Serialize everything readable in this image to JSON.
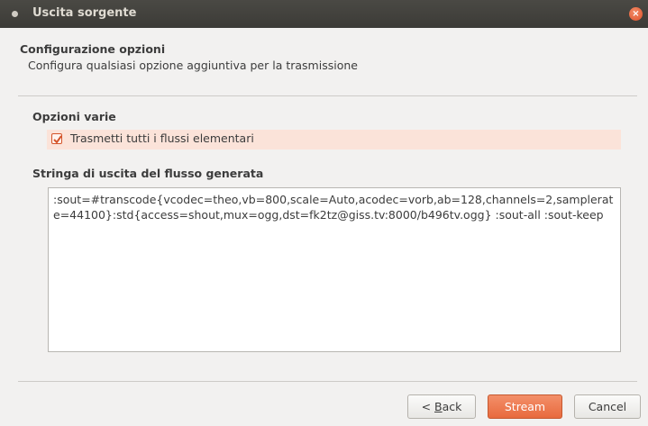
{
  "window": {
    "title": "Uscita sorgente",
    "close_glyph": "×"
  },
  "header": {
    "title": "Configurazione opzioni",
    "subtitle": "Configura qualsiasi opzione aggiuntiva per la trasmissione"
  },
  "misc_options": {
    "title": "Opzioni varie",
    "checkbox_label": "Trasmetti tutti i flussi elementari",
    "checked": true
  },
  "output_string": {
    "title": "Stringa di uscita del flusso generata",
    "value": ":sout=#transcode{vcodec=theo,vb=800,scale=Auto,acodec=vorb,ab=128,channels=2,samplerate=44100}:std{access=shout,mux=ogg,dst=fk2tz@giss.tv:8000/b496tv.ogg} :sout-all :sout-keep"
  },
  "buttons": {
    "back_prefix": "< ",
    "back_mnemonic": "B",
    "back_rest": "ack",
    "stream": "Stream",
    "cancel": "Cancel"
  },
  "colors": {
    "accent": "#e86a3e",
    "titlebar": "#3c3b37",
    "highlight": "#fbe3d9"
  }
}
